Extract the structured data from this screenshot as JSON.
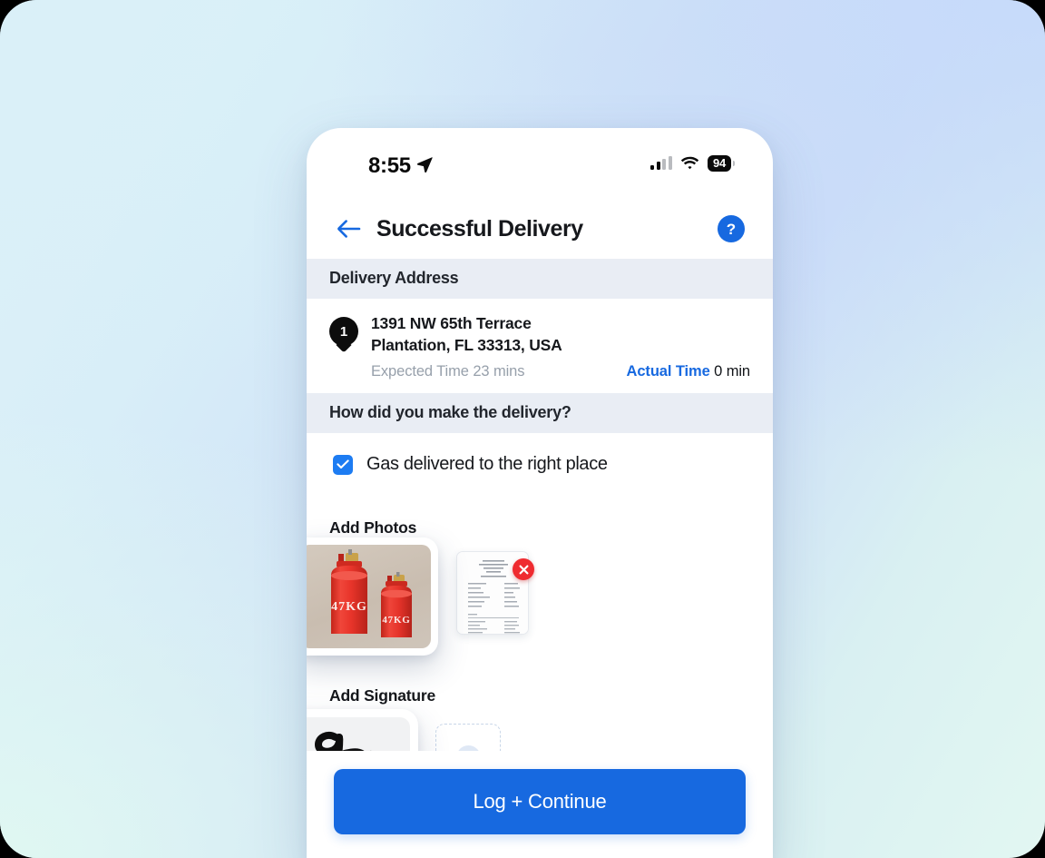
{
  "status_bar": {
    "time": "8:55",
    "location_icon": "location-arrow-icon",
    "signal_icon": "cellular-signal-icon",
    "wifi_icon": "wifi-icon",
    "battery_level": "94"
  },
  "nav": {
    "back_icon": "arrow-left-icon",
    "title": "Successful Delivery",
    "help_label": "?",
    "help_icon": "question-mark-icon"
  },
  "delivery_address": {
    "section_title": "Delivery Address",
    "stop_number": "1",
    "line1": "1391 NW 65th Terrace",
    "line2": "Plantation, FL 33313, USA",
    "expected_time_label": "Expected Time 23 mins",
    "actual_time_label": "Actual Time",
    "actual_time_value": "0 min"
  },
  "delivery_method": {
    "section_title": "How did you make the delivery?",
    "checkbox_label": "Gas delivered to the right place",
    "checkbox_checked": true,
    "check_icon": "checkmark-icon"
  },
  "photos": {
    "label": "Add Photos",
    "items": [
      {
        "name": "gas-cylinders-photo",
        "caption_large": "47KG",
        "caption_small": "47KG"
      },
      {
        "name": "receipt-photo"
      }
    ],
    "delete_icon": "close-x-icon"
  },
  "signature": {
    "label": "Add Signature",
    "signature_name": "handwritten-signature",
    "add_icon": "plus-icon"
  },
  "footer": {
    "cta_label": "Log + Continue"
  },
  "colors": {
    "accent_blue": "#1769e0",
    "checkbox_blue": "#1d7cf2",
    "delete_red": "#ef2b30",
    "section_header_bg": "#e9edf4",
    "muted_text": "#97a0ab",
    "photo_bg": "#cfc5ba"
  }
}
